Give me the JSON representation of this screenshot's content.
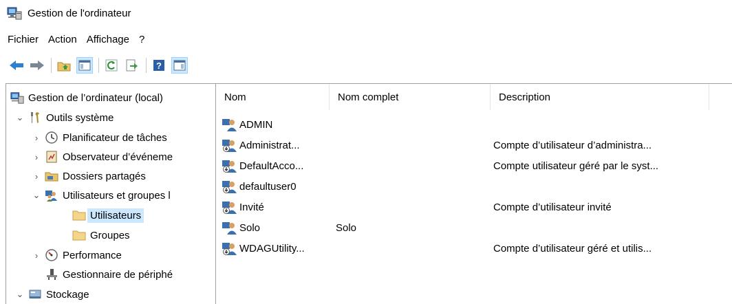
{
  "window": {
    "title": "Gestion de l'ordinateur"
  },
  "menu": [
    "Fichier",
    "Action",
    "Affichage",
    "?"
  ],
  "toolbar": {
    "buttons": [
      "back-icon",
      "forward-icon",
      "up-folder-icon",
      "show-hide-tree-icon",
      "refresh-icon",
      "export-list-icon",
      "help-icon",
      "show-hide-action-pane-icon"
    ]
  },
  "tree": {
    "root": "Gestion de l’ordinateur (local)",
    "system_tools": "Outils système",
    "task_scheduler": "Planificateur de tâches",
    "event_viewer": "Observateur d’événeme",
    "shared_folders": "Dossiers partagés",
    "local_users_groups": "Utilisateurs et groupes l",
    "users": "Utilisateurs",
    "groups": "Groupes",
    "performance": "Performance",
    "device_manager": "Gestionnaire de périphé",
    "storage": "Stockage"
  },
  "columns": {
    "name": "Nom",
    "full_name": "Nom complet",
    "description": "Description"
  },
  "users": [
    {
      "name": "ADMIN",
      "full_name": "",
      "description": "",
      "disabled": false
    },
    {
      "name": "Administrat...",
      "full_name": "",
      "description": "Compte d’utilisateur d’administra...",
      "disabled": true
    },
    {
      "name": "DefaultAcco...",
      "full_name": "",
      "description": "Compte utilisateur géré par le syst...",
      "disabled": true
    },
    {
      "name": "defaultuser0",
      "full_name": "",
      "description": "",
      "disabled": true
    },
    {
      "name": "Invité",
      "full_name": "",
      "description": "Compte d’utilisateur invité",
      "disabled": true
    },
    {
      "name": "Solo",
      "full_name": "Solo",
      "description": "",
      "disabled": false
    },
    {
      "name": "WDAGUtility...",
      "full_name": "",
      "description": "Compte d’utilisateur géré et utilis...",
      "disabled": true
    }
  ],
  "colors": {
    "selection": "#cce8ff",
    "arrow": "#2f7fd1",
    "folder": "#f5d58a"
  }
}
